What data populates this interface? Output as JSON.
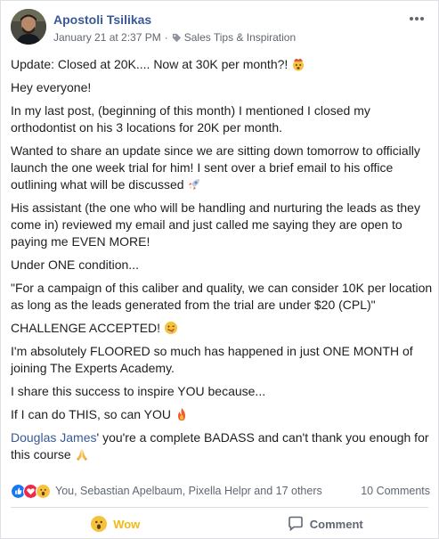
{
  "post": {
    "author": "Apostoli Tsilikas",
    "timestamp": "January 21 at 2:37 PM",
    "separator": "·",
    "group_name": "Sales Tips & Inspiration",
    "paragraphs": [
      "Update: Closed at 20K.... Now at 30K per month?!",
      "Hey everyone!",
      "In my last post, (beginning of this month) I mentioned I closed my orthodontist on his 3 locations for 20K per month.",
      "Wanted to share an update since we are sitting down tomorrow to officially launch the one week trial for him! I sent over a brief email to his office outlining what will be discussed",
      "His assistant (the one who will be handling and nurturing the leads as they come in) reviewed my email and just called me saying they are open to paying me EVEN MORE!",
      "Under ONE condition...",
      "\"For a campaign of this caliber and quality, we can consider 10K per location as long as the leads generated from the trial are under $20 (CPL)\"",
      "CHALLENGE ACCEPTED!",
      "I'm absolutely FLOORED so much has happened in just ONE MONTH of joining The Experts Academy.",
      "I share this success to inspire YOU because...",
      "If I can do THIS, so can YOU"
    ],
    "mention": "Douglas James",
    "mention_tail": "' you're a complete BADASS and can't thank you enough for this course",
    "emojis": {
      "p0": "exploding-head-emoji",
      "p3": "rocket-emoji",
      "p7": "winking-tongue-emoji",
      "p10": "fire-emoji",
      "last": "folded-hands-emoji"
    }
  },
  "reactions": {
    "icons": [
      "like-reaction-icon",
      "love-reaction-icon",
      "wow-reaction-icon"
    ],
    "names": "You, Sebastian Apelbaum, Pixella Helpr and 17 others",
    "comments_count": "10 Comments"
  },
  "actions": {
    "wow_label": "Wow",
    "comment_label": "Comment"
  },
  "colors": {
    "link": "#385898",
    "wow": "#f0ba15",
    "secondary_text": "#616770"
  }
}
